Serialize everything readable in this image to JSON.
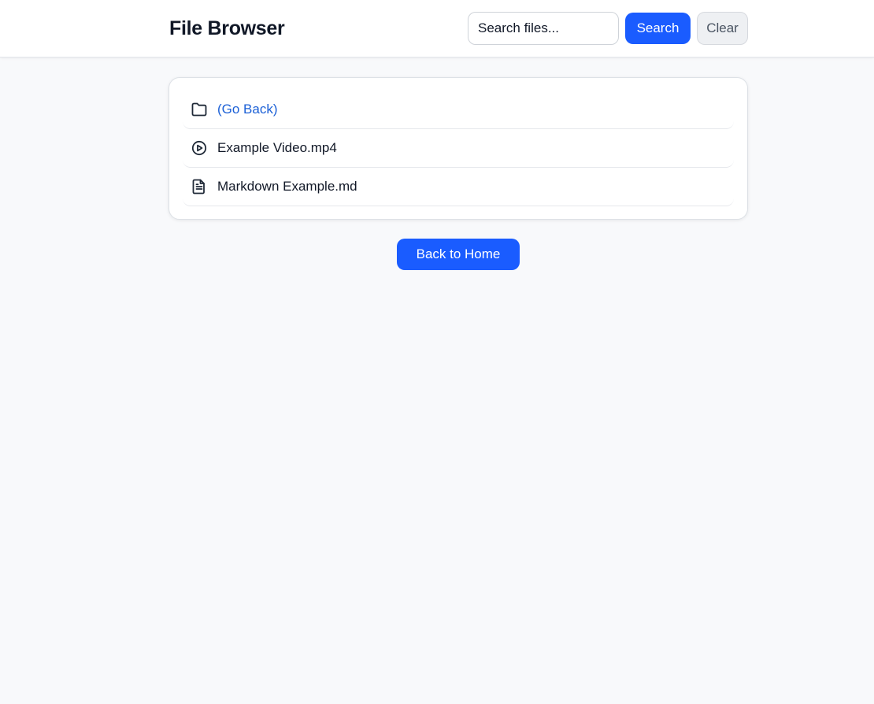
{
  "header": {
    "title": "File Browser",
    "search": {
      "placeholder": "Search files...",
      "value": ""
    },
    "search_button_label": "Search",
    "clear_button_label": "Clear"
  },
  "files": [
    {
      "name": "(Go Back)",
      "icon": "folder-icon",
      "kind": "parent-link"
    },
    {
      "name": "Example Video.mp4",
      "icon": "play-circle-icon",
      "kind": "video"
    },
    {
      "name": "Markdown Example.md",
      "icon": "document-icon",
      "kind": "document"
    }
  ],
  "back_home_label": "Back to Home",
  "colors": {
    "accent": "#1a5cff",
    "link": "#1a5fd6",
    "background": "#f8f9fb"
  }
}
